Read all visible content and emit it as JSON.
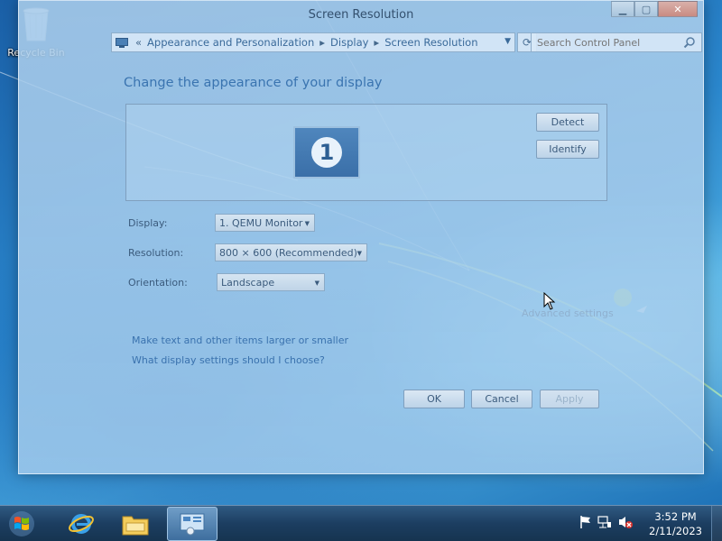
{
  "desktop": {
    "icons": [
      {
        "label": "Recycle Bin"
      }
    ]
  },
  "window": {
    "title": "Screen Resolution",
    "caption": {
      "minimize": "▁",
      "maximize": "▢",
      "close": "✕"
    },
    "address": {
      "crumbs": [
        "Appearance and Personalization",
        "Display",
        "Screen Resolution"
      ]
    },
    "search": {
      "placeholder": "Search Control Panel"
    },
    "heading": "Change the appearance of your display",
    "monitor_number": "1",
    "buttons": {
      "detect": "Detect",
      "identify": "Identify"
    },
    "display": {
      "label": "Display:",
      "value": "1. QEMU Monitor"
    },
    "resolution": {
      "label": "Resolution:",
      "value": "800 × 600 (Recommended)"
    },
    "orientation": {
      "label": "Orientation:",
      "value": "Landscape"
    },
    "advanced_link": "Advanced settings",
    "links": [
      "Make text and other items larger or smaller",
      "What display settings should I choose?"
    ],
    "footer": {
      "ok": "OK",
      "cancel": "Cancel",
      "apply": "Apply"
    }
  },
  "taskbar": {
    "clock": {
      "time": "3:52 PM",
      "date": "2/11/2023"
    },
    "items": [
      "internet-explorer",
      "windows-explorer",
      "screen-resolution"
    ]
  }
}
